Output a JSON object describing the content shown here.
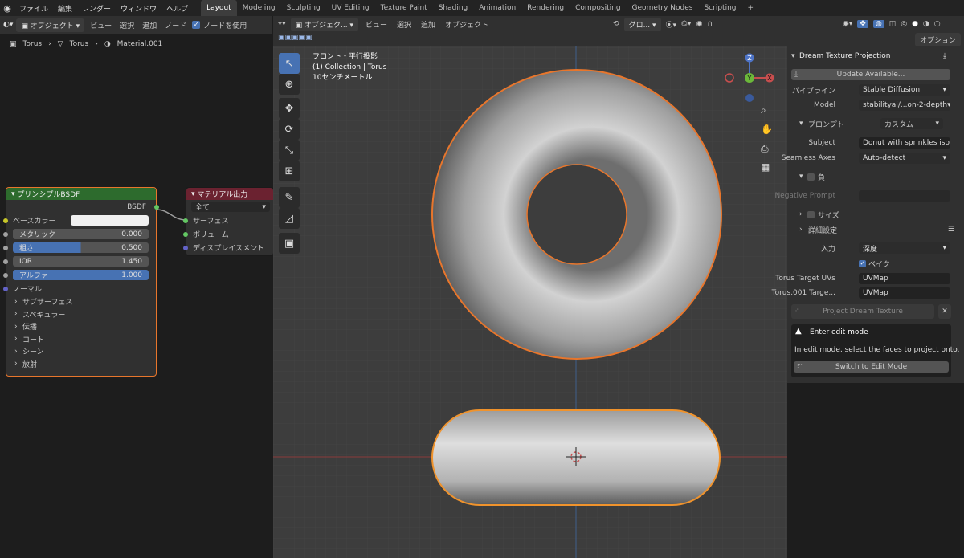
{
  "topbar": {
    "menus": [
      "ファイル",
      "編集",
      "レンダー",
      "ウィンドウ",
      "ヘルプ"
    ],
    "workspaces": [
      "Layout",
      "Modeling",
      "Sculpting",
      "UV Editing",
      "Texture Paint",
      "Shading",
      "Animation",
      "Rendering",
      "Compositing",
      "Geometry Nodes",
      "Scripting"
    ],
    "active_workspace": "Layout",
    "add_tab": "+"
  },
  "node_editor": {
    "header": {
      "object_mode": "オブジェクト",
      "menus": [
        "ビュー",
        "選択",
        "追加",
        "ノード"
      ],
      "use_nodes_label": "ノードを使用"
    },
    "breadcrumb": [
      "Torus",
      "Torus",
      "Material.001"
    ],
    "bsdf": {
      "title": "プリンシプルBSDF",
      "output": "BSDF",
      "base_color": "ベースカラー",
      "fields": [
        {
          "label": "メタリック",
          "value": "0.000",
          "fill": 0
        },
        {
          "label": "粗さ",
          "value": "0.500",
          "fill": 0.5
        },
        {
          "label": "IOR",
          "value": "1.450",
          "fill": 0
        },
        {
          "label": "アルファ",
          "value": "1.000",
          "fill": 1
        }
      ],
      "normal": "ノーマル",
      "sections": [
        "サブサーフェス",
        "スペキュラー",
        "伝播",
        "コート",
        "シーン",
        "放射"
      ]
    },
    "output": {
      "title": "マテリアル出力",
      "target": "全て",
      "inputs": [
        "サーフェス",
        "ボリューム",
        "ディスプレイスメント"
      ]
    }
  },
  "viewport": {
    "header": {
      "mode": "オブジェク...",
      "menus": [
        "ビュー",
        "選択",
        "追加",
        "オブジェクト"
      ],
      "transform": "グロ..."
    },
    "overlay": [
      "フロント・平行投影",
      "(1) Collection | Torus",
      "10センチメートル"
    ],
    "gizmo": {
      "z": "Z",
      "y": "Y",
      "x": "X"
    },
    "options": "オプション"
  },
  "npanel": {
    "title": "Dream Texture Projection",
    "update": "Update Available...",
    "pipeline_label": "パイプライン",
    "pipeline": "Stable Diffusion",
    "model_label": "Model",
    "model": "stabilityai/...on-2-depth",
    "prompt_label": "プロンプト",
    "prompt_mode": "カスタム",
    "subject_label": "Subject",
    "subject": "Donut with sprinkles isol...",
    "seamless_label": "Seamless Axes",
    "seamless": "Auto-detect",
    "negative": "負",
    "negative_prompt_label": "Negative Prompt",
    "size": "サイズ",
    "advanced": "詳細設定",
    "input_label": "入力",
    "input": "深度",
    "bake": "ベイク",
    "uv1_label": "Torus Target UVs",
    "uv1": "UVMap",
    "uv2_label": "Torus.001 Targe...",
    "uv2": "UVMap",
    "project_button": "Project Dream Texture",
    "warn_title": "Enter edit mode",
    "warn_body": "In edit mode, select the faces to project onto.",
    "switch_button": "Switch to Edit Mode"
  },
  "colors": {
    "accent": "#4772b3",
    "selection": "#e8762c",
    "bsdf_header": "#2d6b2d",
    "output_header": "#6b2230"
  }
}
